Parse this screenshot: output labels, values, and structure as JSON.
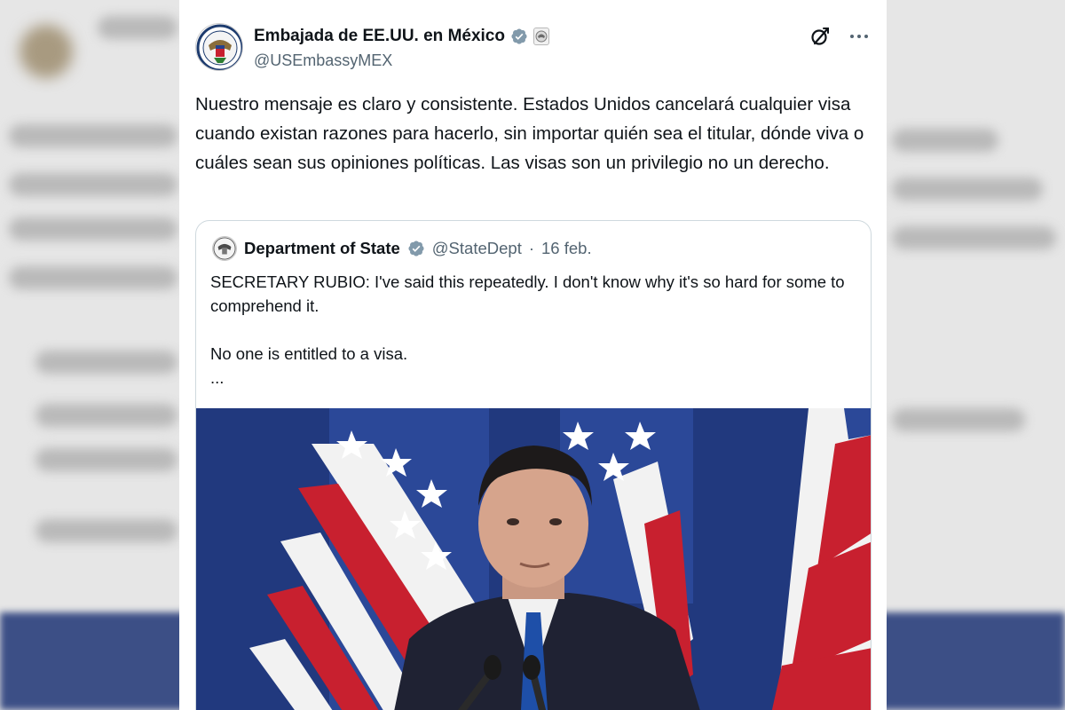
{
  "post": {
    "author_name": "Embajada de EE.UU. en México",
    "author_handle": "@USEmbassyMEX",
    "text": "Nuestro mensaje es claro y consistente. Estados Unidos cancelará cualquier visa cuando existan razones para hacerlo, sin importar quién sea el titular, dónde viva o cuáles sean sus opiniones políticas. Las visas son un privilegio no un derecho.",
    "icons": [
      "verified-badge-icon",
      "government-badge-icon",
      "grok-icon",
      "more-options-icon"
    ]
  },
  "quoted_post": {
    "author_name": "Department of State",
    "author_handle": "@StateDept",
    "separator": "·",
    "date": "16 feb.",
    "text_line1": "SECRETARY RUBIO: I've said this repeatedly. I don't know why it's so hard for some to comprehend it.",
    "text_line2": "No one is entitled to a visa.",
    "text_more": "..."
  },
  "colors": {
    "primary_text": "#0f1419",
    "secondary_text": "#536471",
    "verified": "#829aab",
    "border": "#cfd9de",
    "flag_blue": "#25418d",
    "flag_red": "#c8202f"
  }
}
